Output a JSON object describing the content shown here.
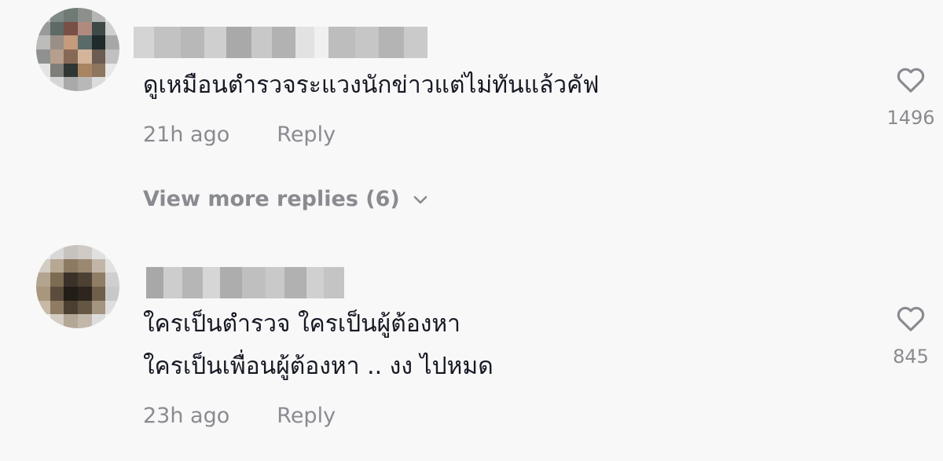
{
  "comments": [
    {
      "text": "ดูเหมือนตำรวจระแวงนักข่าวแต่ไม่ทันแล้วคัฟ",
      "time": "21h ago",
      "reply_label": "Reply",
      "likes": "1496"
    },
    {
      "text_line1": "ใครเป็นตำรวจ ใครเป็นผู้ต้องหา",
      "text_line2": "ใครเป็นเพื่อนผู้ต้องหา .. งง ไปหมด",
      "time": "23h ago",
      "reply_label": "Reply",
      "likes": "845"
    }
  ],
  "view_more": {
    "label": "View more replies (6)",
    "icon": "chevron-down-icon"
  },
  "icons": {
    "like": "heart-outline-icon"
  },
  "colors": {
    "background": "#f8f8f8",
    "text": "#161823",
    "secondary_text": "#8a8b91"
  }
}
